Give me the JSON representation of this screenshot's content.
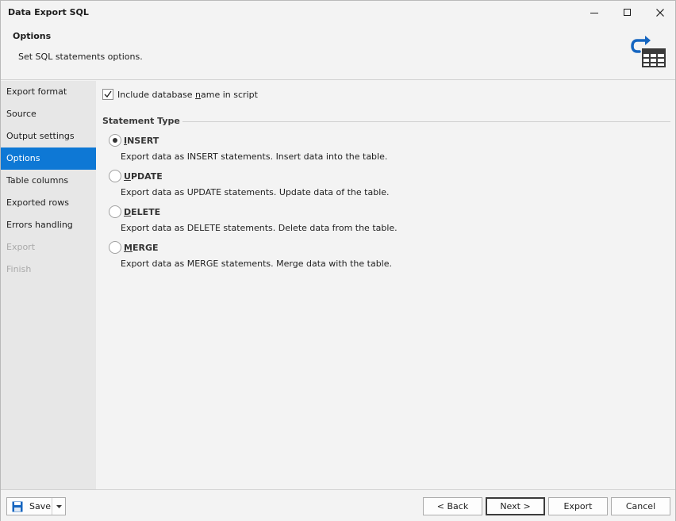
{
  "window": {
    "title": "Data Export SQL"
  },
  "header": {
    "title": "Options",
    "description": "Set SQL statements options.",
    "icon": "export-table-icon",
    "accent_color": "#1565c0"
  },
  "sidebar": {
    "items": [
      {
        "label": "Export format",
        "state": "normal"
      },
      {
        "label": "Source",
        "state": "normal"
      },
      {
        "label": "Output settings",
        "state": "normal"
      },
      {
        "label": "Options",
        "state": "active"
      },
      {
        "label": "Table columns",
        "state": "normal"
      },
      {
        "label": "Exported rows",
        "state": "normal"
      },
      {
        "label": "Errors handling",
        "state": "normal"
      },
      {
        "label": "Export",
        "state": "disabled"
      },
      {
        "label": "Finish",
        "state": "disabled"
      }
    ],
    "active_color": "#0e78d5"
  },
  "options": {
    "include_db_name": {
      "label_pre": "Include database ",
      "label_accel": "n",
      "label_post": "ame in script",
      "checked": true
    },
    "statement_type": {
      "title": "Statement Type",
      "selected": "INSERT",
      "choices": [
        {
          "accel": "I",
          "rest": "NSERT",
          "description": "Export data as INSERT statements. Insert data into the table."
        },
        {
          "accel": "U",
          "rest": "PDATE",
          "description": "Export data as UPDATE statements. Update data of the table."
        },
        {
          "accel": "D",
          "rest": "ELETE",
          "description": "Export data as DELETE statements. Delete data from the table."
        },
        {
          "accel": "M",
          "rest": "ERGE",
          "description": "Export data as MERGE statements. Merge data with the table."
        }
      ]
    }
  },
  "footer": {
    "save_label": "Save",
    "back_label": "< Back",
    "next_label": "Next >",
    "export_label": "Export",
    "cancel_label": "Cancel"
  }
}
